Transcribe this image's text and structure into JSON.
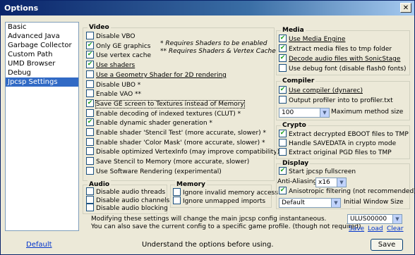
{
  "window": {
    "title": "Options",
    "close_glyph": "✕"
  },
  "sidebar": {
    "items": [
      "Basic",
      "Advanced Java",
      "Garbage Collector",
      "Custom Path",
      "UMD Browser",
      "Debug",
      "Jpcsp Settings"
    ],
    "selected": "Jpcsp Settings"
  },
  "video": {
    "title": "Video",
    "note1": "* Requires Shaders to be enabled",
    "note2": "** Requires Shaders & Vertex Cache",
    "items": [
      {
        "label": "Disable VBO",
        "checked": false
      },
      {
        "label": "Only GE graphics",
        "checked": true
      },
      {
        "label": "Use vertex cache",
        "checked": true
      },
      {
        "label": "Use shaders",
        "checked": true
      },
      {
        "label": "Use a Geometry Shader for 2D rendering",
        "checked": false
      },
      {
        "label": "Disable UBO *",
        "checked": false
      },
      {
        "label": "Enable VAO **",
        "checked": false
      },
      {
        "label": "Save GE screen to Textures instead of Memory",
        "checked": true
      },
      {
        "label": "Enable decoding of indexed textures (CLUT) *",
        "checked": false
      },
      {
        "label": "Enable dynamic shader generation *",
        "checked": true
      },
      {
        "label": "Enable shader 'Stencil Test'  (more accurate, slower) *",
        "checked": false
      },
      {
        "label": "Enable shader 'Color Mask' (more accurate,  slower) *",
        "checked": false
      },
      {
        "label": "Disable optimized VertexInfo (may improve compatibility)",
        "checked": false
      },
      {
        "label": "Save Stencil to Memory  (more accurate,  slower)",
        "checked": false
      },
      {
        "label": "Use Software Rendering (experimental)",
        "checked": false
      }
    ]
  },
  "audio": {
    "title": "Audio",
    "items": [
      {
        "label": "Disable audio threads",
        "checked": false
      },
      {
        "label": "Disable audio channels",
        "checked": false
      },
      {
        "label": "Disable audio blocking",
        "checked": false
      }
    ]
  },
  "memory": {
    "title": "Memory",
    "items": [
      {
        "label": "Ignore invalid memory access",
        "checked": false
      },
      {
        "label": "Ignore unmapped imports",
        "checked": false
      }
    ]
  },
  "media": {
    "title": "Media",
    "items": [
      {
        "label": "Use Media Engine",
        "checked": true
      },
      {
        "label": "Extract media files to tmp folder",
        "checked": true
      },
      {
        "label": "Decode audio files with SonicStage",
        "checked": true
      },
      {
        "label": "Use debug font (disable flash0 fonts)",
        "checked": false
      }
    ]
  },
  "compiler": {
    "title": "Compiler",
    "items": [
      {
        "label": "Use compiler (dynarec)",
        "checked": true
      },
      {
        "label": "Output profiler into to profiler.txt",
        "checked": false
      }
    ],
    "max_method_size_value": "100",
    "max_method_size_label": "Maximum method size"
  },
  "crypto": {
    "title": "Crypto",
    "items": [
      {
        "label": "Extract decrypted EBOOT files to TMP",
        "checked": true
      },
      {
        "label": "Handle SAVEDATA in crypto mode",
        "checked": false
      },
      {
        "label": "Extract original PGD files to TMP",
        "checked": false
      }
    ]
  },
  "display": {
    "title": "Display",
    "start_fullscreen": {
      "label": "Start jpcsp fullscreen",
      "checked": true
    },
    "anti_aliasing_label": "Anti-Aliasing",
    "anti_aliasing_value": "x16",
    "anisotropic": {
      "label": "Anisotropic filtering (not recommended)",
      "checked": true
    },
    "window_size_value": "Default",
    "window_size_label": "Initial Window Size"
  },
  "footer": {
    "hint_line1": "Modifying these settings will change the main jpcsp config instantaneous.",
    "hint_line2": "You can also save the current config to a specific game profile. (though not required)",
    "profile_value": "ULUS00000",
    "save_link": "Save",
    "load_link": "Load",
    "clear_link": "Clear",
    "default_link": "Default",
    "status": "Understand the options before using.",
    "save_button": "Save"
  }
}
